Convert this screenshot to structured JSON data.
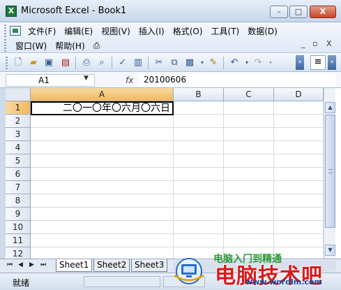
{
  "window": {
    "title": "Microsoft Excel - Book1",
    "app_icon": "excel-icon",
    "minimize": "–",
    "maximize": "□",
    "close": "X"
  },
  "menu": {
    "row1": [
      "文件(F)",
      "编辑(E)",
      "视图(V)",
      "插入(I)",
      "格式(O)",
      "工具(T)",
      "数据(D)"
    ],
    "row2": [
      "窗口(W)",
      "帮助(H)"
    ],
    "mdi": [
      "_",
      "▫",
      "X"
    ]
  },
  "formula_bar": {
    "name_box": "A1",
    "fx": "fx",
    "formula": "20100606"
  },
  "grid": {
    "columns": [
      "A",
      "B",
      "C",
      "D"
    ],
    "rows": [
      "1",
      "2",
      "3",
      "4",
      "5",
      "6",
      "7",
      "8",
      "9",
      "10",
      "11",
      "12"
    ],
    "active_cell": "A1",
    "a1_display": "二〇一〇年〇六月〇六日"
  },
  "sheets": {
    "nav": [
      "⏮",
      "◀",
      "▶",
      "⏭"
    ],
    "tabs": [
      "Sheet1",
      "Sheet2",
      "Sheet3"
    ]
  },
  "status": {
    "text": "就绪"
  },
  "watermark": {
    "title": "电脑技术吧",
    "subtitle": "电脑入门到精通",
    "url": "www.wordlm.com"
  },
  "colors": {
    "active_header": "#f1b85e",
    "watermark_red": "#d81b1b",
    "excel_green": "#1e7a3a"
  }
}
